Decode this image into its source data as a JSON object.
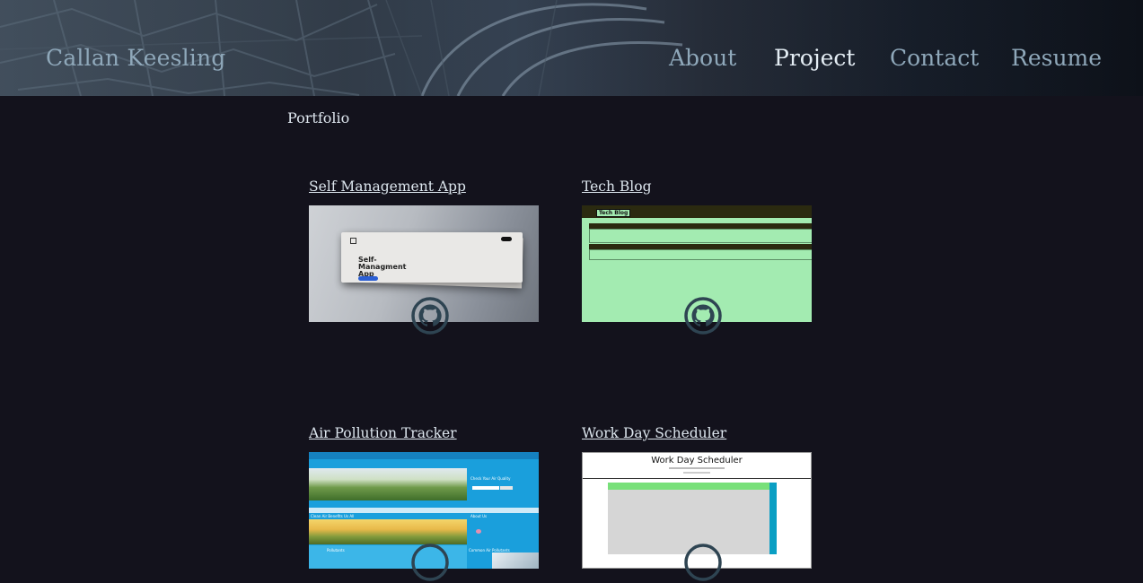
{
  "header": {
    "brand": "Callan Keesling",
    "nav": [
      {
        "label": "About",
        "active": false
      },
      {
        "label": "Project",
        "active": true
      },
      {
        "label": "Contact",
        "active": false
      },
      {
        "label": "Resume",
        "active": false
      }
    ]
  },
  "main": {
    "section_title": "Portfolio",
    "projects": [
      {
        "title": "Self Management App",
        "thumb_heading": "Self-Managment App",
        "icon": "github-icon"
      },
      {
        "title": "Tech Blog",
        "thumb_heading": "Tech Blog",
        "icon": "github-icon"
      },
      {
        "title": "Air Pollution Tracker",
        "thumb_heading": "Check Your Air Quality",
        "thumb_sub1": "Clean Air Benefits Us All",
        "thumb_sub2": "About Us",
        "thumb_sub3": "Pollutants",
        "thumb_sub4": "Common Air Pollutants",
        "icon": "github-icon"
      },
      {
        "title": "Work Day Scheduler",
        "thumb_heading": "Work Day Scheduler",
        "icon": "github-icon"
      }
    ]
  },
  "colors": {
    "background": "#13121c",
    "nav_text": "#8fa8ba",
    "nav_active": "#e4edf4",
    "github_icon": "#2e4452",
    "tech_blog_green": "#a3ebb1",
    "air_blue": "#1a9fdc"
  }
}
